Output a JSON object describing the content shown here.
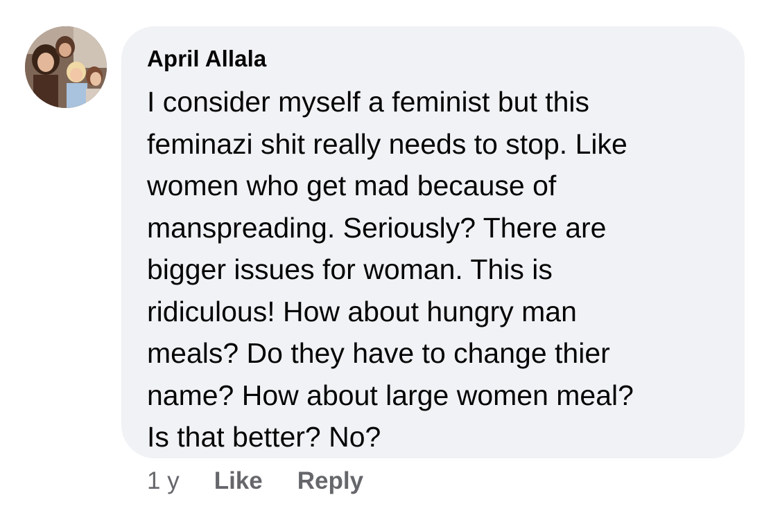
{
  "comment": {
    "author": "April Allala",
    "text": "I consider myself a feminist but this\nfeminazi shit really needs to stop. Like\nwomen who get mad because of\nmanspreading. Seriously? There are\nbigger issues for woman. This is\nridiculous! How about hungry man\nmeals? Do they have to change thier\nname? How about large women meal?\nIs that better? No?",
    "timestamp": "1 y",
    "like_label": "Like",
    "reply_label": "Reply",
    "avatar_icon": "profile-photo-avatar"
  },
  "colors": {
    "bubble_background": "#f0f2f5",
    "text_primary": "#050505",
    "text_secondary": "#65676b"
  }
}
